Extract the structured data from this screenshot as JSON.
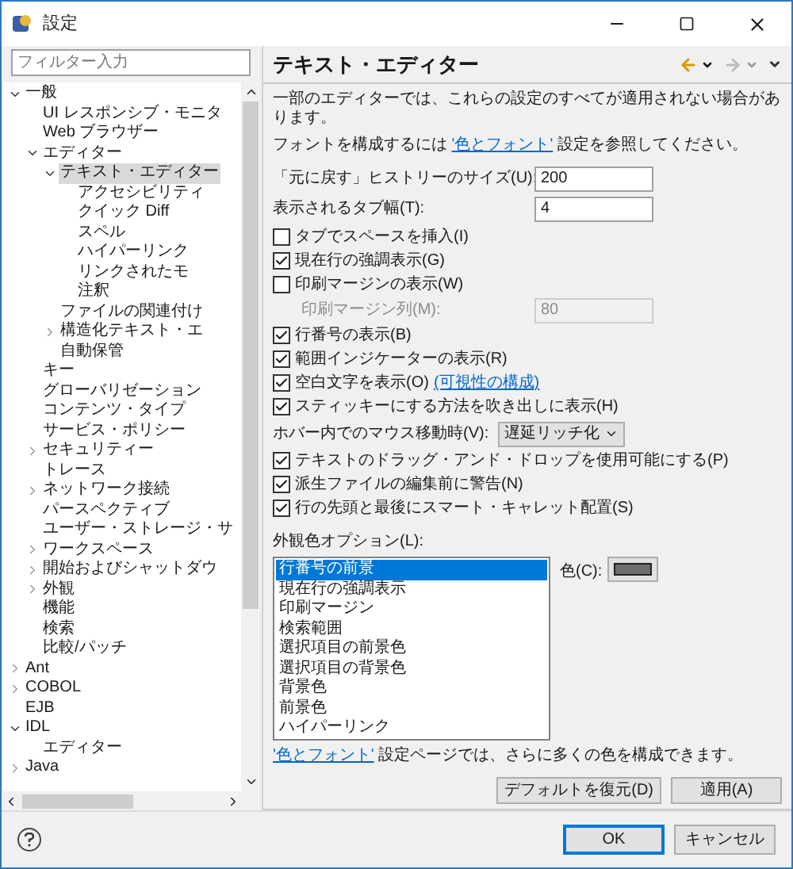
{
  "window": {
    "title": "設定"
  },
  "tree": {
    "filter_placeholder": "フィルター入力",
    "items": [
      {
        "label": "一般",
        "expanded": true,
        "selected": false,
        "children": [
          {
            "label": "UI レスポンシブ・モニタ",
            "selected": false
          },
          {
            "label": "Web ブラウザー",
            "selected": false
          },
          {
            "label": "エディター",
            "expanded": true,
            "selected": false,
            "children": [
              {
                "label": "テキスト・エディター",
                "expanded": true,
                "selected": true,
                "children": [
                  {
                    "label": "アクセシビリティ",
                    "selected": false
                  },
                  {
                    "label": "クイック Diff",
                    "selected": false
                  },
                  {
                    "label": "スペル",
                    "selected": false
                  },
                  {
                    "label": "ハイパーリンク",
                    "selected": false
                  },
                  {
                    "label": "リンクされたモ",
                    "selected": false
                  },
                  {
                    "label": "注釈",
                    "selected": false
                  }
                ]
              },
              {
                "label": "ファイルの関連付け",
                "selected": false
              },
              {
                "label": "構造化テキスト・エ",
                "expanded": false,
                "selected": false
              },
              {
                "label": "自動保管",
                "selected": false
              }
            ]
          },
          {
            "label": "キー",
            "selected": false
          },
          {
            "label": "グローバリゼーション",
            "selected": false
          },
          {
            "label": "コンテンツ・タイプ",
            "selected": false
          },
          {
            "label": "サービス・ポリシー",
            "selected": false
          },
          {
            "label": "セキュリティー",
            "expanded": false,
            "selected": false
          },
          {
            "label": "トレース",
            "selected": false
          },
          {
            "label": "ネットワーク接続",
            "expanded": false,
            "selected": false
          },
          {
            "label": "パースペクティブ",
            "selected": false
          },
          {
            "label": "ユーザー・ストレージ・サ",
            "selected": false
          },
          {
            "label": "ワークスペース",
            "expanded": false,
            "selected": false
          },
          {
            "label": "開始およびシャットダウ",
            "expanded": false,
            "selected": false
          },
          {
            "label": "外観",
            "expanded": false,
            "selected": false
          },
          {
            "label": "機能",
            "selected": false
          },
          {
            "label": "検索",
            "selected": false
          },
          {
            "label": "比較/パッチ",
            "selected": false
          }
        ]
      },
      {
        "label": "Ant",
        "expanded": false,
        "selected": false
      },
      {
        "label": "COBOL",
        "expanded": false,
        "selected": false
      },
      {
        "label": "EJB",
        "selected": false
      },
      {
        "label": "IDL",
        "expanded": true,
        "selected": false,
        "children": [
          {
            "label": "エディター",
            "selected": false
          }
        ]
      },
      {
        "label": "Java",
        "expanded": false,
        "selected": false
      }
    ]
  },
  "editor": {
    "title": "テキスト・エディター",
    "note": "一部のエディターでは、これらの設定のすべてが適用されない場合があります。",
    "font_note": {
      "before": "フォントを構成するには ",
      "link": "'色とフォント'",
      "after": " 設定を参照してください。"
    },
    "fields": [
      {
        "label": "「元に戻す」ヒストリーのサイズ(U):",
        "value": "200"
      },
      {
        "label": "表示されるタブ幅(T):",
        "value": "4"
      }
    ],
    "options": [
      {
        "kind": "checkbox",
        "label": "タブでスペースを挿入(I)",
        "checked": false
      },
      {
        "kind": "checkbox",
        "label": "現在行の強調表示(G)",
        "checked": true
      },
      {
        "kind": "checkbox",
        "label": "印刷マージンの表示(W)",
        "checked": false
      },
      {
        "kind": "field",
        "label": "印刷マージン列(M):",
        "value": "80",
        "disabled": true
      },
      {
        "kind": "checkbox",
        "label": "行番号の表示(B)",
        "checked": true
      },
      {
        "kind": "checkbox",
        "label": "範囲インジケーターの表示(R)",
        "checked": true
      },
      {
        "kind": "checkbox",
        "label": "空白文字を表示(O)",
        "checked": true,
        "link": "(可視性の構成)"
      },
      {
        "kind": "checkbox",
        "label": "スティッキーにする方法を吹き出しに表示(H)",
        "checked": true
      },
      {
        "kind": "select",
        "label": "ホバー内でのマウス移動時(V):",
        "value": "遅延リッチ化"
      },
      {
        "kind": "checkbox",
        "label": "テキストのドラッグ・アンド・ドロップを使用可能にする(P)",
        "checked": true
      },
      {
        "kind": "checkbox",
        "label": "派生ファイルの編集前に警告(N)",
        "checked": true
      },
      {
        "kind": "checkbox",
        "label": "行の先頭と最後にスマート・キャレット配置(S)",
        "checked": true
      }
    ],
    "appearance": {
      "label": "外観色オプション(L):",
      "items": [
        {
          "label": "行番号の前景",
          "selected": true
        },
        {
          "label": "現在行の強調表示",
          "selected": false
        },
        {
          "label": "印刷マージン",
          "selected": false
        },
        {
          "label": "検索範囲",
          "selected": false
        },
        {
          "label": "選択項目の前景色",
          "selected": false
        },
        {
          "label": "選択項目の背景色",
          "selected": false
        },
        {
          "label": "背景色",
          "selected": false
        },
        {
          "label": "前景色",
          "selected": false
        },
        {
          "label": "ハイパーリンク",
          "selected": false
        }
      ],
      "color_label": "色(C):",
      "color": "#6e6e6e"
    },
    "footer_note": {
      "link": "'色とフォント'",
      "after": " 設定ページでは、さらに多くの色を構成できます。"
    },
    "page_buttons": [
      "デフォルトを復元(D)",
      "適用(A)"
    ]
  },
  "dialog_buttons": [
    {
      "label": "OK",
      "default": true
    },
    {
      "label": "キャンセル",
      "default": false
    }
  ]
}
